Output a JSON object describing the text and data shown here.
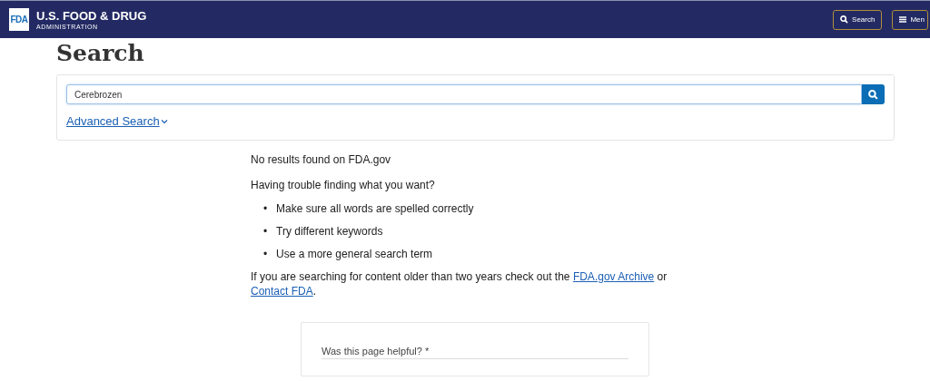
{
  "header": {
    "logo_mark": "FDA",
    "logo_title": "U.S. FOOD & DRUG",
    "logo_subtitle": "ADMINISTRATION",
    "search_button": "Search",
    "menu_button": "Men"
  },
  "title": "Search",
  "search": {
    "value": "Cerebrozen",
    "advanced_link": "Advanced Search"
  },
  "results": {
    "message": "No results found on FDA.gov",
    "trouble": "Having trouble finding what you want?",
    "tip_marker": "•",
    "tips": [
      "Make sure all words are spelled correctly",
      "Try different keywords",
      "Use a more general search term"
    ],
    "archive_text": "If you are searching for content older than two years check out the",
    "archive_link": "FDA.gov Archive",
    "or_text": "or",
    "contact_link": "Contact FDA",
    "end_text": "."
  },
  "feedback": {
    "question": "Was this page helpful? *"
  }
}
